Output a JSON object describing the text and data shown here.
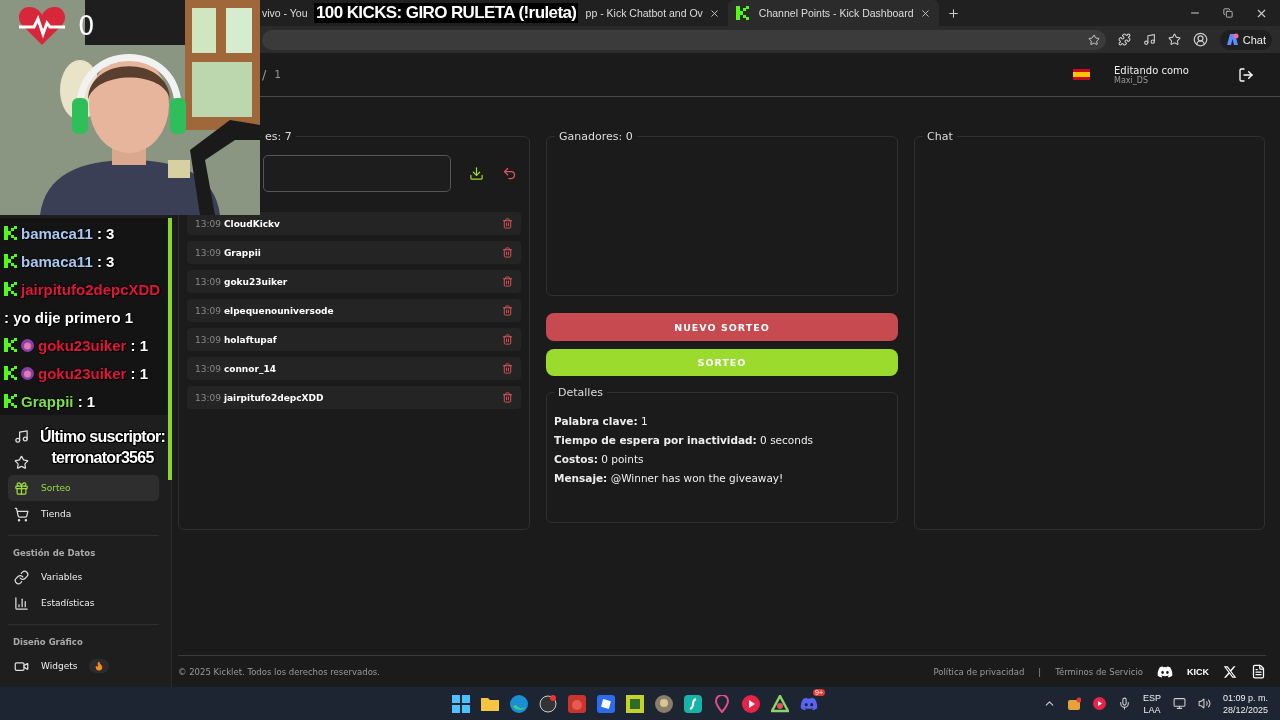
{
  "stream_overlay": {
    "title": "100 KICKS: GIRO RULETA (!ruleta)",
    "heart_count": "0",
    "chat": [
      {
        "user": "bamaca11",
        "color": "#a9c8f0",
        "badge": false,
        "message": " : 3"
      },
      {
        "user": "bamaca11",
        "color": "#a9c8f0",
        "badge": false,
        "message": " : 3"
      },
      {
        "user": "jairpitufo2depcXDD",
        "color": "#e0163b",
        "badge": false,
        "message": " : yo dije primero 1"
      },
      {
        "user": "goku23uiker",
        "color": "#e0163b",
        "badge": true,
        "message": " : 1"
      },
      {
        "user": "goku23uiker",
        "color": "#e0163b",
        "badge": true,
        "message": " : 1"
      },
      {
        "user": "Grappii",
        "color": "#7ee04a",
        "badge": false,
        "message": " : 1"
      }
    ],
    "latest_subscriber": {
      "label": "Último suscriptor:",
      "name": "terronator3565"
    }
  },
  "browser": {
    "tabs": [
      {
        "title": "vivo - You",
        "selected": false,
        "close_visible": false
      },
      {
        "title": "pp - Kick Chatbot and Ov",
        "selected": false,
        "close_visible": true
      },
      {
        "title": "Channel Points - Kick Dashboard",
        "selected": true,
        "close_visible": true
      }
    ],
    "chat_button": "Chat"
  },
  "header": {
    "breadcrumb": [
      "/",
      "1"
    ],
    "editing_label": "Editando como",
    "user": "Maxi_DS"
  },
  "sidebar": {
    "sections": [
      {
        "items": [
          {
            "selected": false
          },
          {
            "selected": false
          },
          {
            "label": "Sorteo",
            "selected": true
          },
          {
            "label": "Tienda",
            "selected": false
          }
        ]
      },
      {
        "title": "Gestión de Datos",
        "items": [
          {
            "label": "Variables",
            "selected": false
          },
          {
            "label": "Estadísticas",
            "selected": false
          }
        ]
      },
      {
        "title": "Diseño Gráfico",
        "items": [
          {
            "label": "Widgets",
            "selected": false,
            "hot": true
          }
        ]
      }
    ]
  },
  "participants": {
    "title": "es: 7",
    "entries": [
      {
        "time": "13:09",
        "name": "CloudKickv"
      },
      {
        "time": "13:09",
        "name": "Grappii"
      },
      {
        "time": "13:09",
        "name": "goku23uiker"
      },
      {
        "time": "13:09",
        "name": "elpequenouniversode"
      },
      {
        "time": "13:09",
        "name": "holaftupaf"
      },
      {
        "time": "13:09",
        "name": "connor_14"
      },
      {
        "time": "13:09",
        "name": "jairpitufo2depcXDD"
      }
    ]
  },
  "winners": {
    "title": "Ganadores: 0"
  },
  "actions": [
    {
      "label": "NUEVO SORTEO",
      "kind": "danger"
    },
    {
      "label": "SORTEO",
      "kind": "primary"
    }
  ],
  "details": {
    "title": "Detalles",
    "lines": [
      {
        "label": "Palabra clave:",
        "value": "1"
      },
      {
        "label": "Tiempo de espera por inactividad:",
        "value": "0 seconds"
      },
      {
        "label": "Costos:",
        "value": "0 points"
      },
      {
        "label": "Mensaje:",
        "value": "@Winner has won the giveaway!"
      }
    ]
  },
  "chat_panel": {
    "title": "Chat"
  },
  "footer": {
    "copyright": "© 2025 Kicklet. Todos los derechos reservados.",
    "links": [
      "Política de privacidad",
      "Términos de Servicio"
    ],
    "separator": "|",
    "kick_logo": "KICK"
  },
  "taskbar": {
    "discord_badge": "9+",
    "language": [
      "ESP",
      "LAA"
    ],
    "time": "01:09 p. m.",
    "date": "28/12/2025"
  }
}
